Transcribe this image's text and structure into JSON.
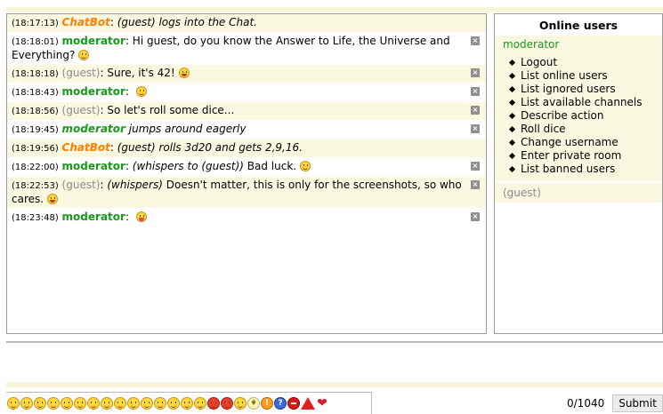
{
  "messages": [
    {
      "time": "(18:17:13)",
      "user": "ChatBot",
      "user_type": "chatbot",
      "sep": ": ",
      "text": "(guest) logs into the Chat.",
      "italic": true,
      "deletable": false,
      "smiley": null
    },
    {
      "time": "(18:18:01)",
      "user": "moderator",
      "user_type": "mod",
      "sep": ": ",
      "text": "Hi guest, do you know the Answer to Life, the Universe and Everything?",
      "italic": false,
      "deletable": true,
      "smiley": "smile"
    },
    {
      "time": "(18:18:18)",
      "user": "(guest)",
      "user_type": "guest",
      "sep": ": ",
      "text": "Sure, it's 42!",
      "italic": false,
      "deletable": true,
      "smiley": "grin"
    },
    {
      "time": "(18:18:43)",
      "user": "moderator",
      "user_type": "mod",
      "sep": ": ",
      "text": "",
      "italic": false,
      "deletable": true,
      "smiley": "smile"
    },
    {
      "time": "(18:18:56)",
      "user": "(guest)",
      "user_type": "guest",
      "sep": ": ",
      "text": "So let's roll some dice...",
      "italic": false,
      "deletable": true,
      "smiley": null
    },
    {
      "time": "(18:19:45)",
      "user": "moderator",
      "user_type": "mod",
      "sep": " ",
      "text": "jumps around eagerly",
      "italic": true,
      "deletable": true,
      "smiley": null
    },
    {
      "time": "(18:19:56)",
      "user": "ChatBot",
      "user_type": "chatbot",
      "sep": ": ",
      "text": "(guest) rolls 3d20 and gets 2,9,16.",
      "italic": true,
      "deletable": false,
      "smiley": null
    },
    {
      "time": "(18:22:00)",
      "user": "moderator",
      "user_type": "mod",
      "sep": ": ",
      "prefix": "(whispers to (guest))",
      "text": "Bad luck.",
      "italic": false,
      "deletable": true,
      "smiley": "smile"
    },
    {
      "time": "(18:22:53)",
      "user": "(guest)",
      "user_type": "guest",
      "sep": ": ",
      "prefix": "(whispers)",
      "text": "Doesn't matter, this is only for the screenshots, so who cares.",
      "italic": false,
      "deletable": true,
      "smiley": "grin"
    },
    {
      "time": "(18:23:48)",
      "user": "moderator",
      "user_type": "mod",
      "sep": ": ",
      "text": "",
      "italic": false,
      "deletable": true,
      "smiley": "tongue"
    }
  ],
  "online": {
    "title": "Online users",
    "current_user": "moderator",
    "menu": [
      "Logout",
      "List online users",
      "List ignored users",
      "List available channels",
      "Describe action",
      "Roll dice",
      "Change username",
      "Enter private room",
      "List banned users"
    ],
    "other_user": "(guest)"
  },
  "input": {
    "counter": "0/1040",
    "submit_label": "Submit"
  },
  "emoticons": [
    "smile",
    "sad",
    "wink",
    "grin",
    "laugh",
    "neutral",
    "surprised",
    "confused",
    "cool",
    "nerd",
    "shades",
    "tongue",
    "crying",
    "sick",
    "happy",
    "devil",
    "angry",
    "shock",
    "idea",
    "help",
    "question",
    "stop",
    "warning",
    "heart"
  ],
  "colors": {
    "chatbot": "#ff7f00",
    "moderator": "#1a9a1a",
    "guest": "#8a8a8a",
    "row_bg": "#fbf8e2"
  }
}
